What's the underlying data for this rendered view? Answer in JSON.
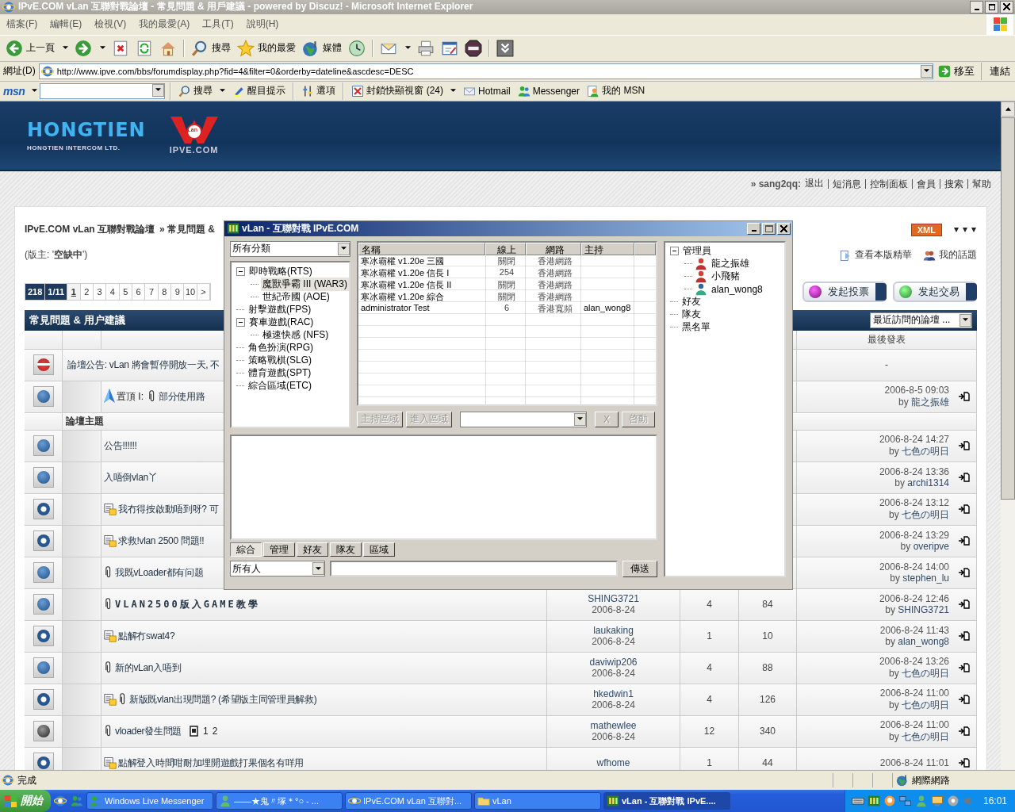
{
  "browser": {
    "title": "IPvE.COM vLan 互聯對戰論壇 - 常見問題 & 用戶建議 - powered by Discuz! - Microsoft Internet Explorer",
    "menu": [
      "檔案(F)",
      "編輯(E)",
      "檢視(V)",
      "我的最愛(A)",
      "工具(T)",
      "說明(H)"
    ],
    "toolbar": [
      [
        {
          "kind": "back",
          "label": "上一頁",
          "caret": true
        },
        {
          "kind": "forward",
          "caret": true
        },
        {
          "kind": "stop"
        },
        {
          "kind": "refresh"
        },
        {
          "kind": "home"
        }
      ],
      [
        {
          "kind": "search",
          "label": "搜尋"
        },
        {
          "kind": "favorites",
          "label": "我的最愛"
        },
        {
          "kind": "media",
          "label": "媒體"
        },
        {
          "kind": "history"
        }
      ],
      [
        {
          "kind": "mail",
          "caret": true
        },
        {
          "kind": "print"
        },
        {
          "kind": "edit"
        },
        {
          "kind": "game"
        }
      ],
      [
        {
          "kind": "more"
        }
      ]
    ],
    "address_label": "網址(D)",
    "url": "http://www.ipve.com/bbs/forumdisplay.php?fid=4&filter=0&orderby=dateline&ascdesc=DESC",
    "go": "移至",
    "links": "連結",
    "msn": {
      "logo": "msn",
      "search": "搜尋",
      "items": [
        {
          "kind": "highlight",
          "label": "醒目提示"
        },
        {
          "kind": "options",
          "label": "選項"
        },
        {
          "kind": "popup",
          "label": "封鎖快顯視窗 (24)",
          "caret": true
        },
        {
          "kind": "hotmail",
          "label": "Hotmail"
        },
        {
          "kind": "messenger",
          "label": "Messenger"
        },
        {
          "kind": "mymsn",
          "label": "我的 MSN"
        }
      ]
    },
    "status": "完成",
    "zone": "網際網路"
  },
  "site": {
    "logo": "HONGTIEN",
    "logo_sub": "HONGTIEN INTERCOM LTD.",
    "logo2_mark": "Lan",
    "logo2": "IPVE.COM",
    "user": "» sang2qq:",
    "user_links": [
      "退出",
      "短消息",
      "控制面板",
      "會員",
      "搜索",
      "幫助"
    ]
  },
  "forum": {
    "breadcrumb": [
      "IPvE.COM vLan 互聯對戰論壇",
      "» 常見問題 &"
    ],
    "moderator": "(版主: '**空缺中**')",
    "xml": "XML",
    "links": [
      {
        "kind": "digest",
        "label": "查看本版精華"
      },
      {
        "kind": "mine",
        "label": "我的話題"
      }
    ],
    "pager": [
      {
        "label": "218",
        "kind": "info",
        "selected": false
      },
      {
        "label": "1/11",
        "kind": "info",
        "selected": false
      },
      {
        "label": "1",
        "kind": "page",
        "selected": true
      },
      {
        "label": "2",
        "kind": "page",
        "selected": false
      },
      {
        "label": "3",
        "kind": "page",
        "selected": false
      },
      {
        "label": "4",
        "kind": "page",
        "selected": false
      },
      {
        "label": "5",
        "kind": "page",
        "selected": false
      },
      {
        "label": "6",
        "kind": "page",
        "selected": false
      },
      {
        "label": "7",
        "kind": "page",
        "selected": false
      },
      {
        "label": "8",
        "kind": "page",
        "selected": false
      },
      {
        "label": "9",
        "kind": "page",
        "selected": false
      },
      {
        "label": "10",
        "kind": "page",
        "selected": false
      },
      {
        "label": ">",
        "kind": "page",
        "selected": false
      }
    ],
    "buttons": [
      "发起投票",
      "发起交易"
    ],
    "table_title": "常見問題 & 用户建議",
    "jump": "最近訪問的論壇 ...",
    "last_header": "最後發表",
    "rows": [
      {
        "kind": "announcement",
        "title": "論壇公告: vLan 將會暫停開放一天, 不",
        "last": "-"
      },
      {
        "kind": "sticky",
        "new": false,
        "hot": false,
        "prefix": "置頂 I:",
        "attachment": true,
        "title": "部分使用路",
        "last_date": "2006-8-5 09:03",
        "last_by": "by",
        "last_user": "龍之振雄"
      },
      {
        "kind": "section",
        "title": "論壇主題"
      },
      {
        "kind": "thread",
        "new": false,
        "hot": false,
        "poll": false,
        "attachment": false,
        "title": "公告!!!!!!",
        "last_date": "2006-8-24 14:27",
        "last_by": "by",
        "last_user": "七色の明日"
      },
      {
        "kind": "thread",
        "new": false,
        "hot": false,
        "poll": false,
        "attachment": false,
        "title": "入唔倒vlan丫",
        "last_date": "2006-8-24 13:36",
        "last_by": "by",
        "last_user": "archi1314"
      },
      {
        "kind": "thread",
        "new": true,
        "hot": false,
        "poll": true,
        "attachment": false,
        "title": "我冇得按啟動唔到呀? 可",
        "last_date": "2006-8-24 13:12",
        "last_by": "by",
        "last_user": "七色の明日"
      },
      {
        "kind": "thread",
        "new": true,
        "hot": false,
        "poll": true,
        "attachment": false,
        "title": "求救!vlan 2500 問題!!",
        "last_date": "2006-8-24 13:29",
        "last_by": "by",
        "last_user": "overipve"
      },
      {
        "kind": "thread",
        "new": false,
        "hot": false,
        "poll": false,
        "attachment": true,
        "title": "我既vLoader都有问题",
        "last_date": "2006-8-24 14:00",
        "last_by": "by",
        "last_user": "stephen_lu"
      },
      {
        "kind": "thread",
        "new": false,
        "hot": false,
        "poll": false,
        "attachment": true,
        "title": "VLAN2500版入GAME教學",
        "author": "SHING3721",
        "date": "2006-8-24",
        "replies": "4",
        "views": "84",
        "last_date": "2006-8-24 12:46",
        "last_by": "by",
        "last_user": "SHING3721"
      },
      {
        "kind": "thread",
        "new": true,
        "hot": false,
        "poll": true,
        "attachment": false,
        "title": "點解冇swat4?",
        "author": "laukaking",
        "date": "2006-8-24",
        "replies": "1",
        "views": "10",
        "last_date": "2006-8-24 11:43",
        "last_by": "by",
        "last_user": "alan_wong8"
      },
      {
        "kind": "thread",
        "new": false,
        "hot": false,
        "poll": false,
        "attachment": true,
        "title": "新的vLan入唔到",
        "author": "daviwip206",
        "date": "2006-8-24",
        "replies": "4",
        "views": "88",
        "last_date": "2006-8-24 13:26",
        "last_by": "by",
        "last_user": "七色の明日"
      },
      {
        "kind": "thread",
        "new": true,
        "hot": false,
        "poll": true,
        "attachment": true,
        "title": "新版既vlan出現問題? (希望版主同管理員解救)",
        "author": "hkedwin1",
        "date": "2006-8-24",
        "replies": "4",
        "views": "126",
        "last_date": "2006-8-24 11:00",
        "last_by": "by",
        "last_user": "七色の明日"
      },
      {
        "kind": "thread",
        "new": false,
        "hot": true,
        "poll": false,
        "attachment": true,
        "title": "vloader發生問題",
        "pages": [
          "1",
          "2"
        ],
        "author": "mathewlee",
        "date": "2006-8-24",
        "replies": "12",
        "views": "340",
        "last_date": "2006-8-24 11:00",
        "last_by": "by",
        "last_user": "七色の明日"
      },
      {
        "kind": "thread",
        "new": true,
        "hot": false,
        "poll": true,
        "attachment": false,
        "title": "點解登入時間咁耐加埋開遊戲打果個名有咩用",
        "author": "wfhome",
        "replies": "1",
        "views": "44",
        "last_date": "2006-8-24 11:01"
      }
    ]
  },
  "dialog": {
    "title": "vLan - 互聯對戰 IPvE.COM",
    "category": "所有分類",
    "tree": [
      {
        "label": "即時戰略(RTS)",
        "selected": false,
        "expanded": true,
        "children": [
          {
            "label": "魔獸爭霸 III (WAR3)",
            "selected": true
          },
          {
            "label": "世紀帝國 (AOE)",
            "selected": false
          }
        ]
      },
      {
        "label": "射擊遊戲(FPS)",
        "selected": false
      },
      {
        "label": "賽車遊戲(RAC)",
        "selected": false,
        "expanded": true,
        "children": [
          {
            "label": "極速快感 (NFS)",
            "selected": false
          }
        ]
      },
      {
        "label": "角色扮演(RPG)",
        "selected": false
      },
      {
        "label": "策略戰棋(SLG)",
        "selected": false
      },
      {
        "label": "體育遊戲(SPT)",
        "selected": false
      },
      {
        "label": "綜合區域(ETC)",
        "selected": false
      }
    ],
    "columns": [
      "名稱",
      "線上",
      "網路",
      "主持"
    ],
    "rooms": [
      {
        "name": "寒冰霸權 v1.20e  三國",
        "online": "關閉",
        "network": "香港網路"
      },
      {
        "name": "寒冰霸權 v1.20e  信長 I",
        "online": "254",
        "network": "香港網路"
      },
      {
        "name": "寒冰霸權 v1.20e  信長 II",
        "online": "關閉",
        "network": "香港網路"
      },
      {
        "name": "寒冰霸權 v1.20e  綜合",
        "online": "關閉",
        "network": "香港網路"
      },
      {
        "name": "administrator Test",
        "online": "6",
        "network": "香港寬頻",
        "host": "alan_wong8"
      }
    ],
    "actions": [
      {
        "label": "主持區域",
        "disabled": true
      },
      {
        "label": "進入區域",
        "disabled": true
      }
    ],
    "cancel": {
      "label": "X",
      "disabled": true
    },
    "start": {
      "label": "啓動",
      "disabled": true
    },
    "tabs": [
      {
        "label": "綜合",
        "selected": true
      },
      {
        "label": "管理",
        "selected": false
      },
      {
        "label": "好友",
        "selected": false
      },
      {
        "label": "隊友",
        "selected": false
      },
      {
        "label": "區域",
        "selected": false
      }
    ],
    "recipient": "所有人",
    "send": "傳送",
    "contacts": [
      {
        "label": "管理員",
        "expanded": true,
        "children": [
          {
            "label": "龍之振雄",
            "kind": "admin"
          },
          {
            "label": "小飛豬",
            "kind": "admin"
          },
          {
            "label": "alan_wong8",
            "kind": "user"
          }
        ]
      },
      {
        "label": "好友"
      },
      {
        "label": "隊友"
      },
      {
        "label": "黑名單"
      }
    ]
  },
  "taskbar": {
    "start": "開始",
    "quick": [
      {
        "kind": "ie"
      },
      {
        "kind": "messenger"
      }
    ],
    "tasks": [
      {
        "kind": "messenger",
        "label": "Windows Live Messenger",
        "selected": false
      },
      {
        "kind": "chat",
        "label": "——★鬼〃塚＊°○ - ...",
        "selected": false
      },
      {
        "kind": "ie",
        "label": "IPvE.COM vLan 互聯對...",
        "selected": false
      },
      {
        "kind": "folder",
        "label": "vLan",
        "selected": false
      },
      {
        "kind": "app",
        "label": "vLan - 互聯對戰 IPvE....",
        "selected": true
      }
    ],
    "clock": "16:01"
  }
}
